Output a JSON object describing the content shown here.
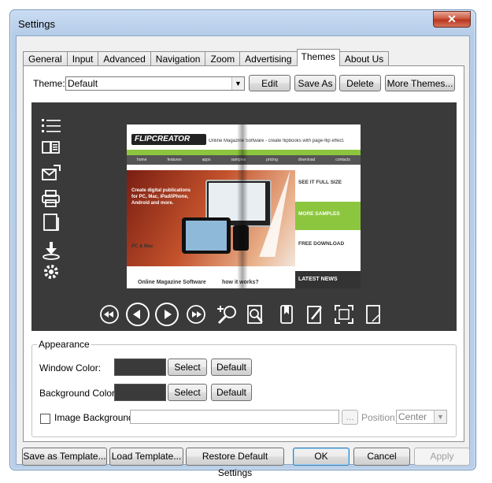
{
  "window": {
    "title": "Settings",
    "close": "✕"
  },
  "tabs": [
    "General",
    "Input",
    "Advanced",
    "Navigation",
    "Zoom",
    "Advertising",
    "Themes",
    "About Us"
  ],
  "theme": {
    "label": "Theme:",
    "value": "Default",
    "edit": "Edit",
    "save_as": "Save As",
    "delete": "Delete",
    "more": "More Themes..."
  },
  "mock_site": {
    "logo": "FLIPCREATOR",
    "tagline": "Online Magazine Software - create flipbooks with page-flip effect.",
    "nav": [
      "home",
      "features",
      "apps",
      "samples",
      "pricing",
      "download",
      "contacts"
    ],
    "hero": "Create digital publications for PC, Mac, iPad/iPhone, Android and more.",
    "pc_mac": "PC & Mac",
    "side1": "SEE IT FULL SIZE",
    "side2": "MORE SAMPLES",
    "side3": "FREE DOWNLOAD",
    "bottom1": "Online Magazine Software",
    "bottom2": "how it works?",
    "bottom3": "LATEST NEWS"
  },
  "appearance": {
    "group_title": "Appearance",
    "window_color_label": "Window Color:",
    "window_color": "#3a3a3a",
    "background_color_label": "Background Color:",
    "background_color": "#3a3a3a",
    "select": "Select",
    "default": "Default",
    "image_background_label": "Image Background:",
    "browse": "...",
    "position_label": "Position:",
    "position_value": "Center"
  },
  "footer": {
    "save_template": "Save as Template...",
    "load_template": "Load Template...",
    "restore": "Restore Default Settings",
    "ok": "OK",
    "cancel": "Cancel",
    "apply": "Apply"
  },
  "colors": {
    "accent_green": "#8cc63f",
    "preview_bg": "#3a3a3a"
  }
}
